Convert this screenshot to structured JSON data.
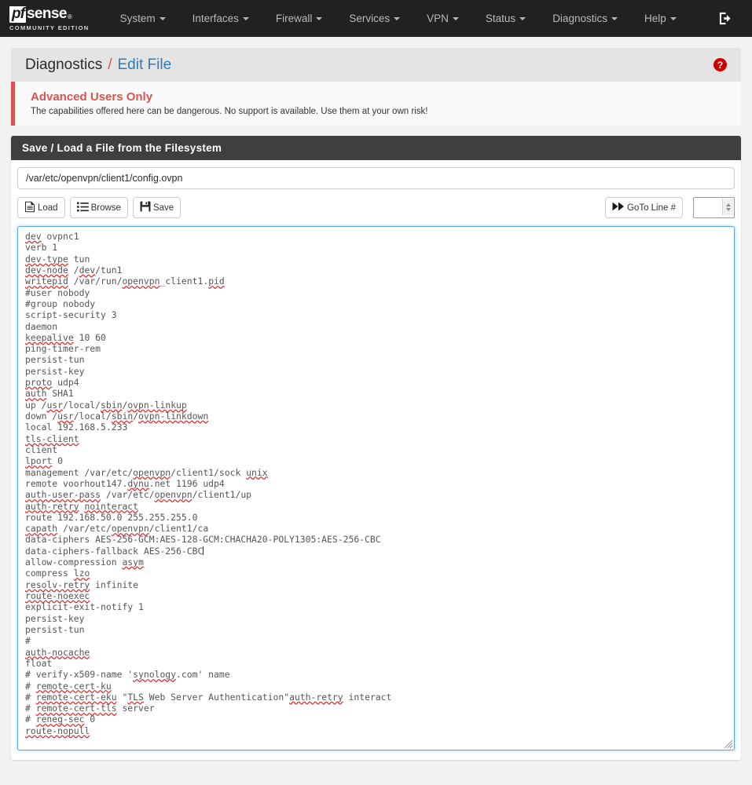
{
  "navbar": {
    "brand": {
      "pf": "pf",
      "sense": "sense",
      "registered": "®",
      "subtitle": "COMMUNITY EDITION"
    },
    "items": [
      {
        "label": "System",
        "has_caret": true
      },
      {
        "label": "Interfaces",
        "has_caret": true
      },
      {
        "label": "Firewall",
        "has_caret": true
      },
      {
        "label": "Services",
        "has_caret": true
      },
      {
        "label": "VPN",
        "has_caret": true
      },
      {
        "label": "Status",
        "has_caret": true
      },
      {
        "label": "Diagnostics",
        "has_caret": true
      },
      {
        "label": "Help",
        "has_caret": true
      }
    ],
    "logout_icon": "logout-icon"
  },
  "breadcrumb": {
    "parent": "Diagnostics",
    "separator": "/",
    "current": "Edit File",
    "help_icon_label": "?"
  },
  "alert": {
    "title": "Advanced Users Only",
    "body": "The capabilities offered here can be dangerous. No support is available. Use them at your own risk!"
  },
  "panel": {
    "title": "Save / Load a File from the Filesystem",
    "path_value": "/var/etc/openvpn/client1/config.ovpn",
    "path_placeholder": "",
    "buttons": [
      {
        "label": "Load",
        "icon": "file-document-icon"
      },
      {
        "label": "Browse",
        "icon": "list-icon"
      },
      {
        "label": "Save",
        "icon": "floppy-disk-icon"
      }
    ],
    "goto": {
      "label": "GoTo Line #",
      "icon": "fast-forward-icon",
      "line_value": "",
      "line_placeholder": ""
    }
  },
  "editor": {
    "lines": [
      [
        {
          "t": "dev",
          "s": true
        },
        {
          "t": " ovpnc1"
        }
      ],
      [
        {
          "t": "verb 1"
        }
      ],
      [
        {
          "t": "dev-type",
          "s": true
        },
        {
          "t": " tun"
        }
      ],
      [
        {
          "t": "dev-node",
          "s": true
        },
        {
          "t": " /"
        },
        {
          "t": "dev",
          "s": true
        },
        {
          "t": "/tun1"
        }
      ],
      [
        {
          "t": "writepid",
          "s": true
        },
        {
          "t": " /var/run/"
        },
        {
          "t": "openvpn",
          "s": true
        },
        {
          "t": "_client1."
        },
        {
          "t": "pid",
          "s": true
        }
      ],
      [
        {
          "t": "#user nobody"
        }
      ],
      [
        {
          "t": "#group nobody"
        }
      ],
      [
        {
          "t": "script-security 3"
        }
      ],
      [
        {
          "t": "daemon"
        }
      ],
      [
        {
          "t": "keepalive",
          "s": true
        },
        {
          "t": " 10 60"
        }
      ],
      [
        {
          "t": "ping-timer-rem"
        }
      ],
      [
        {
          "t": "persist-tun"
        }
      ],
      [
        {
          "t": "persist-key"
        }
      ],
      [
        {
          "t": "proto",
          "s": true
        },
        {
          "t": " udp4"
        }
      ],
      [
        {
          "t": "auth",
          "s": true
        },
        {
          "t": " SHA1"
        }
      ],
      [
        {
          "t": "up /"
        },
        {
          "t": "usr",
          "s": true
        },
        {
          "t": "/local/"
        },
        {
          "t": "sbin",
          "s": true
        },
        {
          "t": "/"
        },
        {
          "t": "ovpn-linkup",
          "s": true
        }
      ],
      [
        {
          "t": "down /"
        },
        {
          "t": "usr",
          "s": true
        },
        {
          "t": "/local/"
        },
        {
          "t": "sbin",
          "s": true
        },
        {
          "t": "/"
        },
        {
          "t": "ovpn-linkdown",
          "s": true
        }
      ],
      [
        {
          "t": "local 192.168.5.233"
        }
      ],
      [
        {
          "t": "tls-client",
          "s": true
        }
      ],
      [
        {
          "t": "client"
        }
      ],
      [
        {
          "t": "lport",
          "s": true
        },
        {
          "t": " 0"
        }
      ],
      [
        {
          "t": "management /var/etc/"
        },
        {
          "t": "openvpn",
          "s": true
        },
        {
          "t": "/client1/sock "
        },
        {
          "t": "unix",
          "s": true
        }
      ],
      [
        {
          "t": "remote voorhout147."
        },
        {
          "t": "dynu",
          "s": true
        },
        {
          "t": ".net 1196 udp4"
        }
      ],
      [
        {
          "t": "auth-user-pass",
          "s": true
        },
        {
          "t": " /var/etc/"
        },
        {
          "t": "openvpn",
          "s": true
        },
        {
          "t": "/client1/up"
        }
      ],
      [
        {
          "t": "auth-retry",
          "s": true
        },
        {
          "t": " "
        },
        {
          "t": "nointeract",
          "s": true
        }
      ],
      [
        {
          "t": "route 192.168.50.0 255.255.255.0"
        }
      ],
      [
        {
          "t": "capath",
          "s": true
        },
        {
          "t": " /var/etc/"
        },
        {
          "t": "openvpn",
          "s": true
        },
        {
          "t": "/client1/ca"
        }
      ],
      [
        {
          "t": "data-ciphers AES-256-GCM:AES-128-GCM:CHACHA20-POLY1305:AES-256-CBC"
        }
      ],
      [
        {
          "t": "data-ciphers-fallback AES-256-CBC"
        },
        {
          "caret": true
        }
      ],
      [
        {
          "t": "allow-compression "
        },
        {
          "t": "asym",
          "s": true
        }
      ],
      [
        {
          "t": "compress "
        },
        {
          "t": "lzo",
          "s": true
        }
      ],
      [
        {
          "t": "resolv-retry",
          "s": true
        },
        {
          "t": " infinite"
        }
      ],
      [
        {
          "t": "route-noexec",
          "s": true
        }
      ],
      [
        {
          "t": "explicit-exit-notify 1"
        }
      ],
      [
        {
          "t": "persist-key"
        }
      ],
      [
        {
          "t": "persist-tun"
        }
      ],
      [
        {
          "t": "#"
        }
      ],
      [
        {
          "t": "auth-nocache",
          "s": true
        }
      ],
      [
        {
          "t": "float"
        }
      ],
      [
        {
          "t": "# verify-x509-name '"
        },
        {
          "t": "synology",
          "s": true
        },
        {
          "t": ".com' name"
        }
      ],
      [
        {
          "t": "# "
        },
        {
          "t": "remote-cert-ku",
          "s": true
        }
      ],
      [
        {
          "t": "# "
        },
        {
          "t": "remote-cert-eku",
          "s": true
        },
        {
          "t": " \""
        },
        {
          "t": "TLS",
          "s": true
        },
        {
          "t": " Web Server Authentication\""
        },
        {
          "t": "auth-retry",
          "s": true
        },
        {
          "t": " interact"
        }
      ],
      [
        {
          "t": "# "
        },
        {
          "t": "remote-cert-tls",
          "s": true
        },
        {
          "t": " server"
        }
      ],
      [
        {
          "t": "# "
        },
        {
          "t": "reneg-sec",
          "s": true
        },
        {
          "t": " 0"
        }
      ],
      [
        {
          "t": "route-nopull",
          "s": true
        }
      ]
    ]
  },
  "colors": {
    "navbar_bg": "#212121",
    "panel_head_bg": "#3f3f3f",
    "alert_accent": "#d9534f",
    "link_blue": "#337ab7",
    "focus_blue": "#5aa9e6",
    "help_red": "#cc0000",
    "page_bg": "#f2f2f2"
  }
}
